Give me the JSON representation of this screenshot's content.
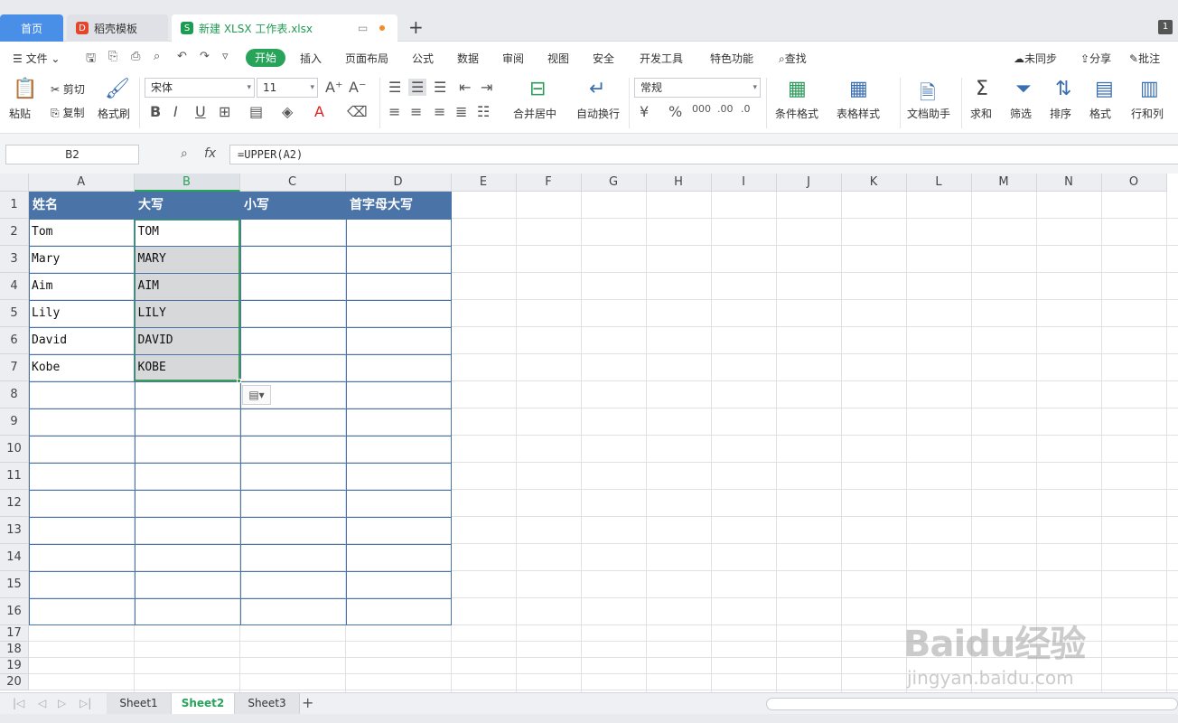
{
  "tabs": {
    "home": "首页",
    "template": "稻壳模板",
    "doc": "新建 XLSX 工作表.xlsx",
    "add": "+",
    "badge": "1"
  },
  "menu": {
    "file": "文件",
    "items": [
      "开始",
      "插入",
      "页面布局",
      "公式",
      "数据",
      "审阅",
      "视图",
      "安全",
      "开发工具",
      "特色功能"
    ],
    "search": "查找",
    "sync": "未同步",
    "share": "分享",
    "comment": "批注"
  },
  "ribbon": {
    "paste": "粘贴",
    "cut": "剪切",
    "copy": "复制",
    "format_painter": "格式刷",
    "font_name": "宋体",
    "font_size": "11",
    "merge": "合并居中",
    "wrap": "自动换行",
    "number_format": "常规",
    "cond_format": "条件格式",
    "table_style": "表格样式",
    "doc_helper": "文档助手",
    "sum": "求和",
    "filter": "筛选",
    "sort": "排序",
    "format": "格式",
    "rowcol": "行和列"
  },
  "formula": {
    "cell_ref": "B2",
    "fx": "fx",
    "content": "=UPPER(A2)"
  },
  "columns": [
    "A",
    "B",
    "C",
    "D",
    "E",
    "F",
    "G",
    "H",
    "I",
    "J",
    "K",
    "L",
    "M",
    "N",
    "O"
  ],
  "rows": [
    "1",
    "2",
    "3",
    "4",
    "5",
    "6",
    "7",
    "8",
    "9",
    "10",
    "11",
    "12",
    "13",
    "14",
    "15",
    "16",
    "17",
    "18",
    "19",
    "20"
  ],
  "sheet": {
    "headers": [
      "姓名",
      "大写",
      "小写",
      "首字母大写"
    ],
    "names": [
      "Tom",
      "Mary",
      "Aim",
      "Lily",
      "David",
      "Kobe"
    ],
    "upper": [
      "TOM",
      "MARY",
      "AIM",
      "LILY",
      "DAVID",
      "KOBE"
    ]
  },
  "sheets": [
    "Sheet1",
    "Sheet2",
    "Sheet3"
  ],
  "active_sheet": "Sheet2",
  "watermark": {
    "brand": "Baidu经验",
    "url": "jingyan.baidu.com"
  }
}
